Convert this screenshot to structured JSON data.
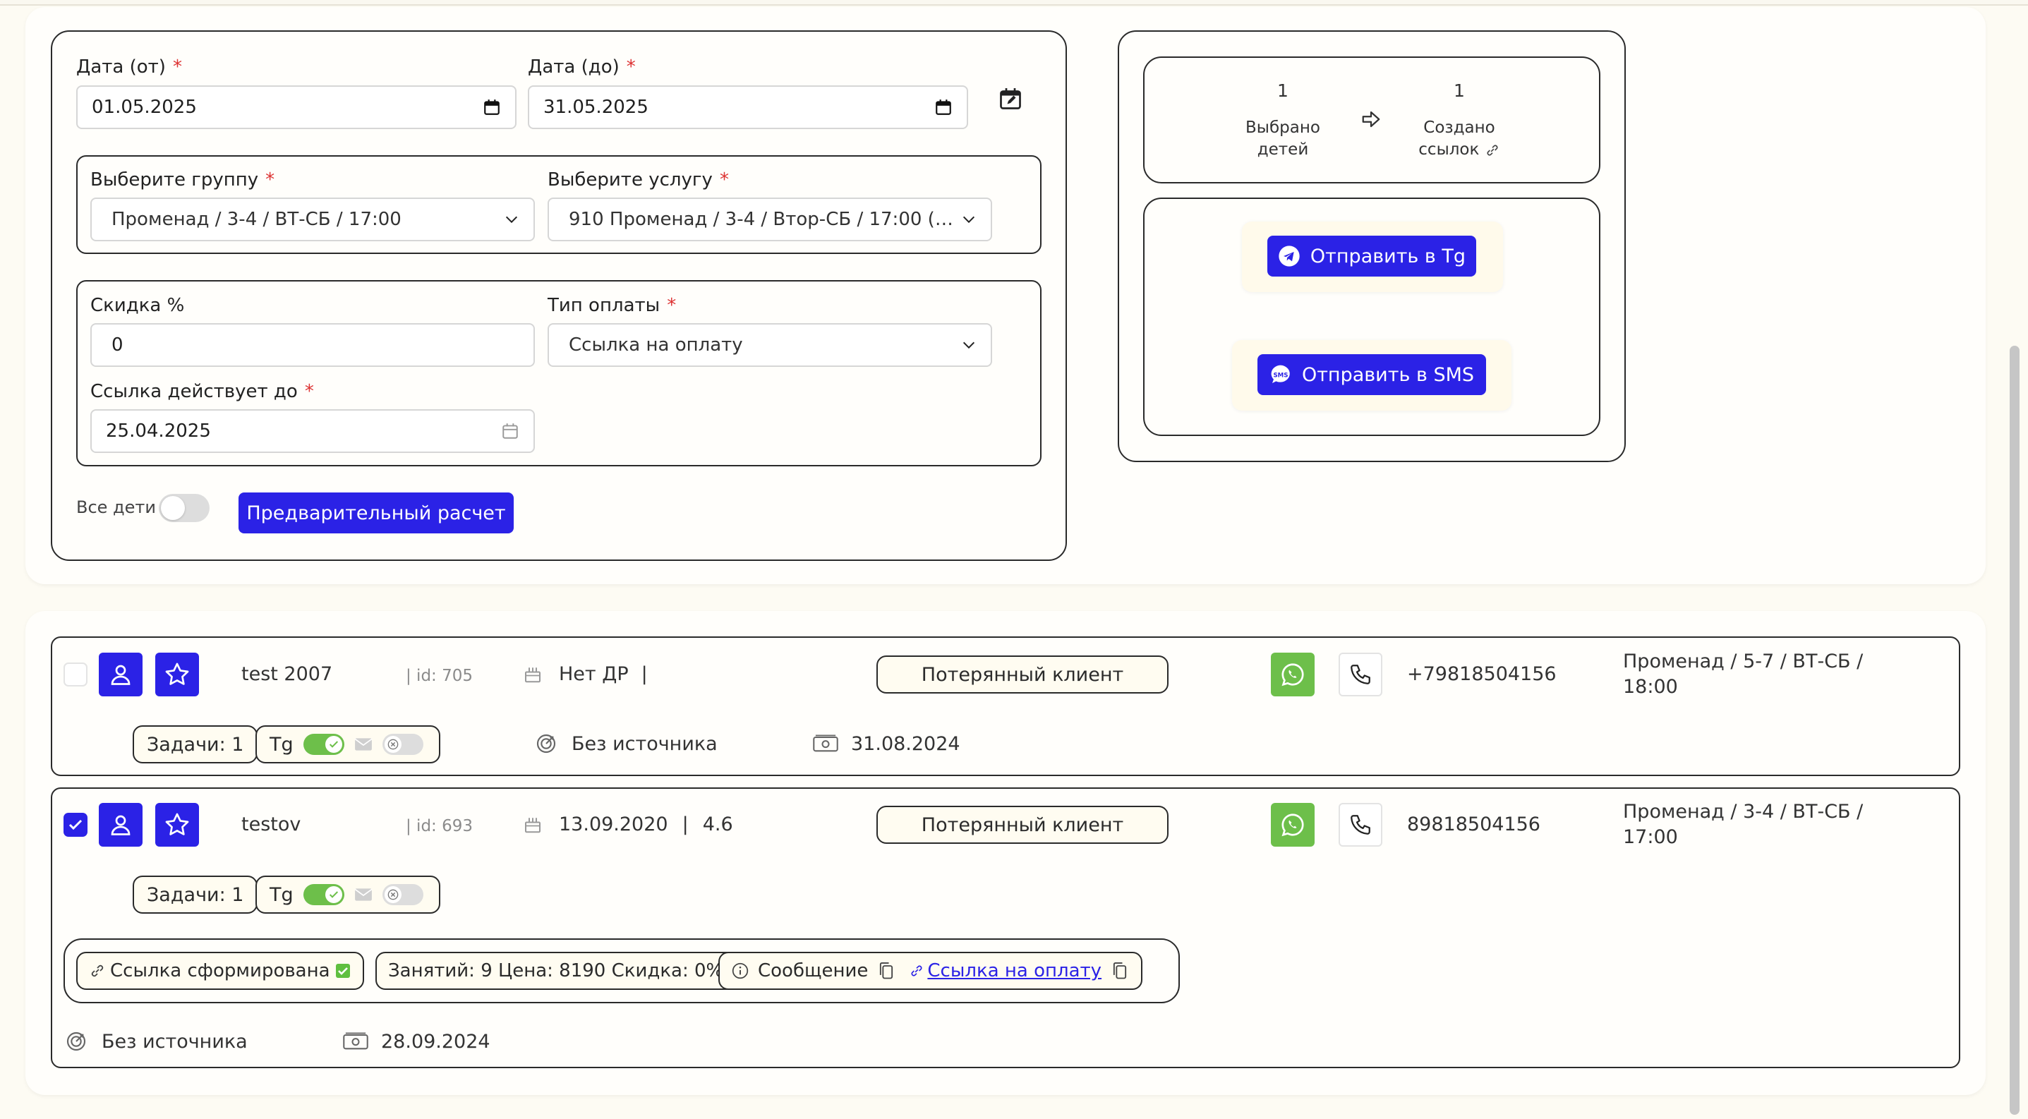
{
  "form": {
    "date_from_label": "Дата (от)",
    "date_from_value": "01.05.2025",
    "date_to_label": "Дата (до)",
    "date_to_value": "31.05.2025",
    "group_label": "Выберите группу",
    "group_value": "Променад / 3-4 / ВТ-СБ / 17:00",
    "service_label": "Выберите услугу",
    "service_value": "910 Променад / 3-4 / Втор-СБ / 17:00 (Або...",
    "discount_label": "Скидка %",
    "discount_value": "0",
    "payment_type_label": "Тип оплаты",
    "payment_type_value": "Ссылка на оплату",
    "link_valid_label": "Ссылка действует до",
    "link_valid_value": "25.04.2025",
    "required_mark": "*",
    "all_children_label": "Все дети",
    "preview_button": "Предварительный расчет"
  },
  "summary": {
    "selected_count": "1",
    "selected_label_line1": "Выбрано",
    "selected_label_line2": "детей",
    "created_count": "1",
    "created_label_line1": "Создано",
    "created_label_line2": "ссылок",
    "send_tg_button": "Отправить в Tg",
    "send_sms_button": "Отправить в SMS"
  },
  "children": [
    {
      "checked": false,
      "name": "test 2007",
      "id_text": "| id: 705",
      "birthday": "Нет ДР",
      "birthday_sep": "|",
      "age": "",
      "status": "Потерянный клиент",
      "phone": "+79818504156",
      "group_line1": "Променад / 5-7 / ВТ-СБ /",
      "group_line2": "18:00",
      "tasks": "Задачи: 1",
      "tg_label": "Tg",
      "source": "Без источника",
      "payment_date": "31.08.2024"
    },
    {
      "checked": true,
      "name": "testov",
      "id_text": "| id: 693",
      "birthday": "13.09.2020",
      "birthday_sep": "|",
      "age": "4.6",
      "status": "Потерянный клиент",
      "phone": "89818504156",
      "group_line1": "Променад / 3-4 / ВТ-СБ /",
      "group_line2": "17:00",
      "tasks": "Задачи: 1",
      "tg_label": "Tg",
      "link_formed": "Ссылка сформирована",
      "lesson_info": "Занятий: 9 Цена: 8190 Скидка: 0%",
      "message_label": "Сообщение",
      "payment_link": "Ссылка на оплату",
      "source": "Без источника",
      "payment_date": "28.09.2024"
    }
  ],
  "colors": {
    "accent": "#2b22e6",
    "whatsapp": "#6dbf4a",
    "required": "#dd3333",
    "background": "#fdfbf3"
  },
  "icons": [
    "calendar-icon",
    "calendar-edit-icon",
    "chevron-down-icon",
    "arrow-right-icon",
    "link-icon",
    "telegram-icon",
    "sms-icon",
    "user-icon",
    "star-icon",
    "whatsapp-icon",
    "phone-icon",
    "cake-icon",
    "source-icon",
    "money-icon",
    "check-icon",
    "close-icon",
    "mail-icon",
    "info-icon",
    "copy-icon"
  ]
}
